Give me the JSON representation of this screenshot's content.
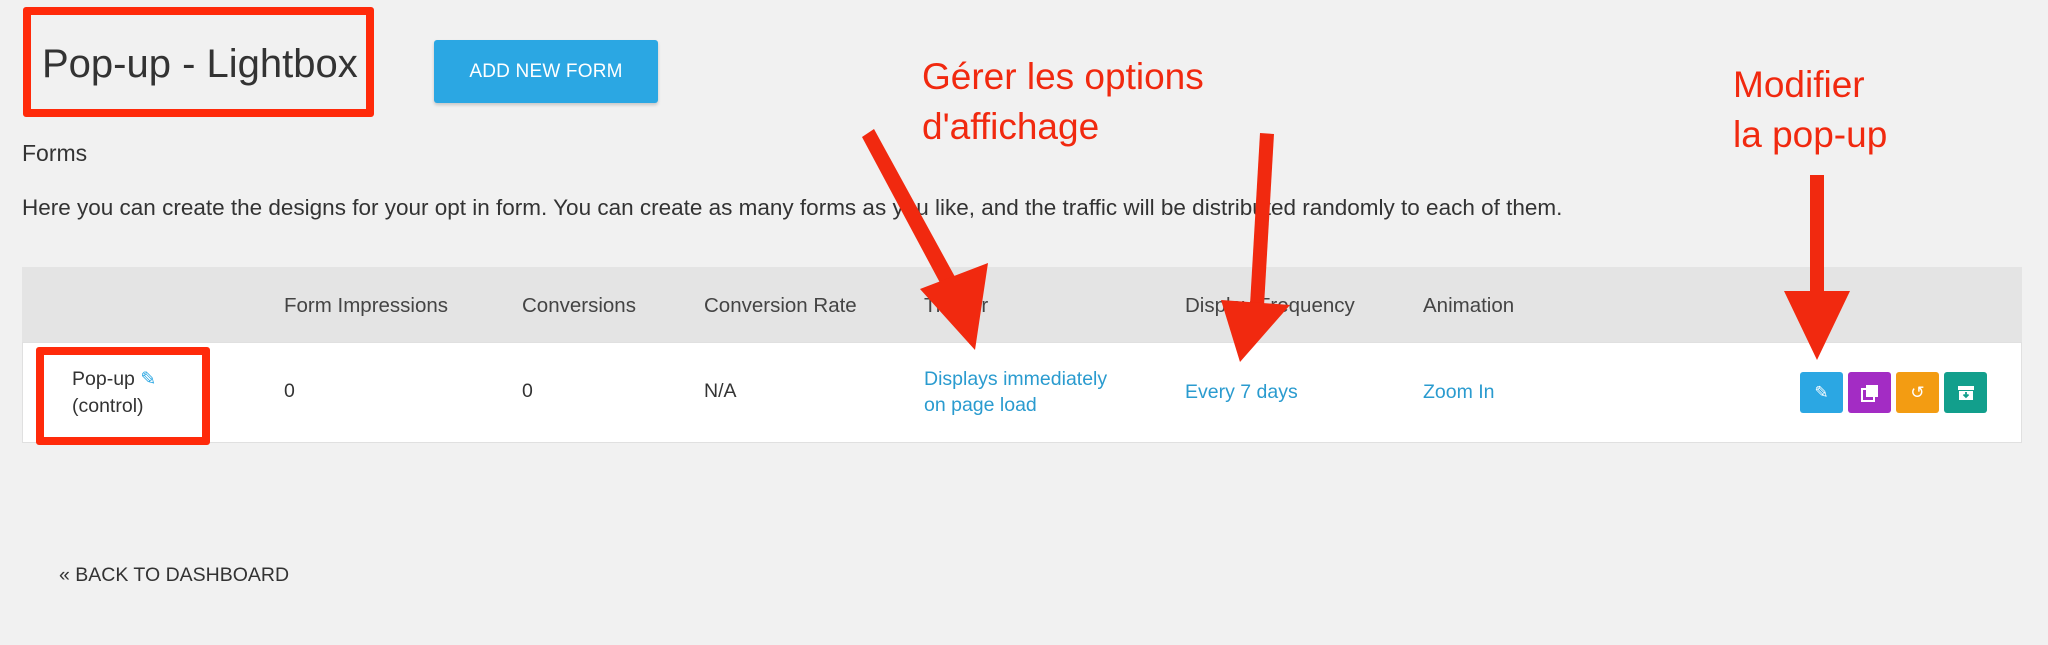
{
  "header": {
    "title": "Pop-up - Lightbox",
    "add_button": "ADD NEW FORM"
  },
  "section_label": "Forms",
  "description": "Here you can create the designs for your opt in form. You can create as many forms as you like, and the traffic will be distributed randomly to each of them.",
  "table": {
    "columns": [
      "",
      "Form Impressions",
      "Conversions",
      "Conversion Rate",
      "Trigger",
      "Display Frequency",
      "Animation"
    ],
    "rows": [
      {
        "form_name": "Pop-up",
        "form_variant": "(control)",
        "impressions": "0",
        "conversions": "0",
        "conversion_rate": "N/A",
        "trigger_line1": "Displays immediately",
        "trigger_line2": "on page load",
        "frequency": "Every 7 days",
        "animation": "Zoom In"
      }
    ]
  },
  "actions": [
    {
      "icon": "pencil-icon",
      "color": "#2ba7e3"
    },
    {
      "icon": "duplicate-icon",
      "color": "#a32cc4"
    },
    {
      "icon": "reset-icon",
      "color": "#f39c12"
    },
    {
      "icon": "archive-icon",
      "color": "#129f8c"
    }
  ],
  "back_link": "« BACK TO DASHBOARD",
  "annotations": {
    "display_options_line1": "Gérer les options",
    "display_options_line2": "d'affichage",
    "edit_line1": "Modifier",
    "edit_line2": "la pop-up",
    "color": "#f1290f"
  }
}
